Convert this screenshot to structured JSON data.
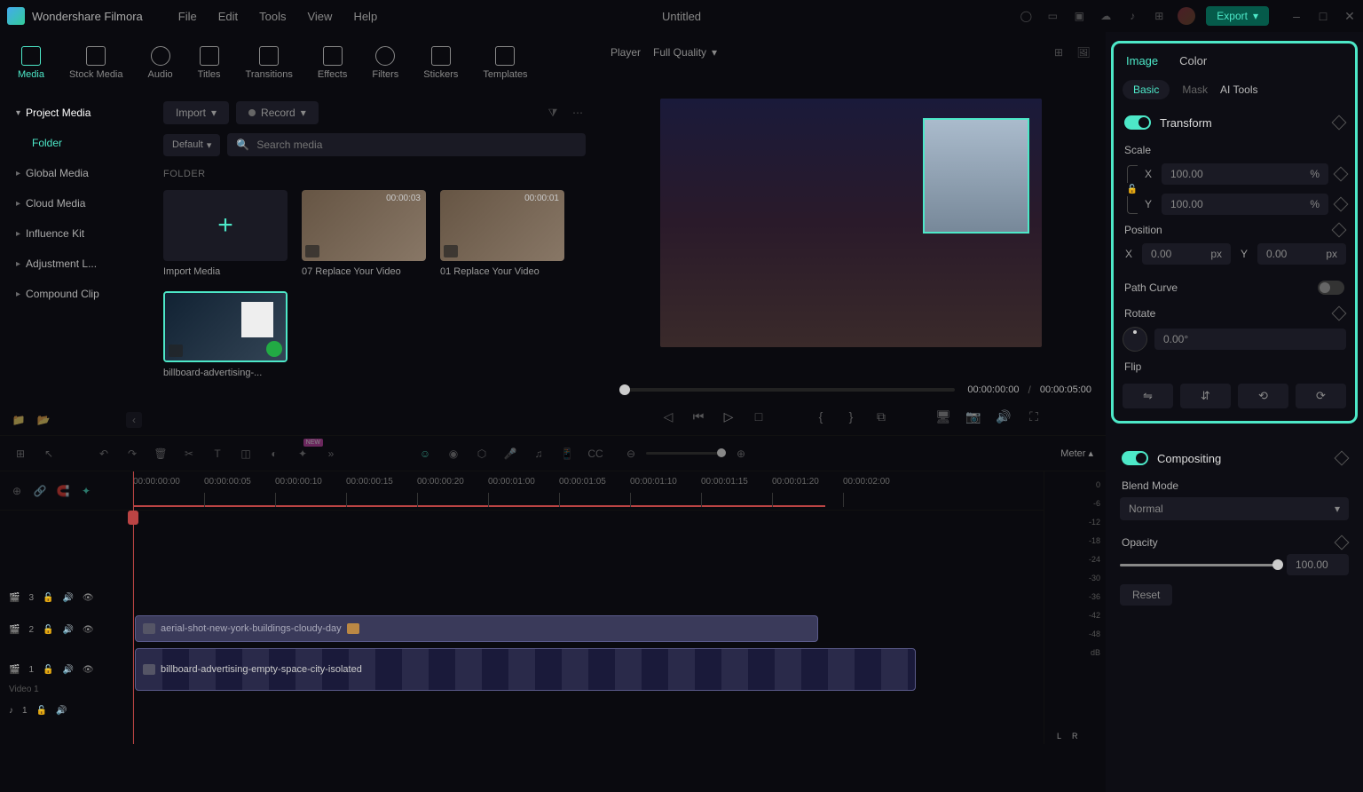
{
  "app_name": "Wondershare Filmora",
  "document_title": "Untitled",
  "menu": [
    "File",
    "Edit",
    "Tools",
    "View",
    "Help"
  ],
  "export_label": "Export",
  "top_tabs": [
    {
      "label": "Media",
      "active": true
    },
    {
      "label": "Stock Media"
    },
    {
      "label": "Audio"
    },
    {
      "label": "Titles"
    },
    {
      "label": "Transitions"
    },
    {
      "label": "Effects"
    },
    {
      "label": "Filters"
    },
    {
      "label": "Stickers"
    },
    {
      "label": "Templates"
    }
  ],
  "sidebar": {
    "items": [
      {
        "label": "Project Media",
        "active": true
      },
      {
        "label": "Folder",
        "highlight": true
      },
      {
        "label": "Global Media"
      },
      {
        "label": "Cloud Media"
      },
      {
        "label": "Influence Kit"
      },
      {
        "label": "Adjustment L..."
      },
      {
        "label": "Compound Clip"
      }
    ]
  },
  "media_toolbar": {
    "import": "Import",
    "record": "Record",
    "sort": "Default",
    "search_placeholder": "Search media"
  },
  "folder_label": "FOLDER",
  "media_items": [
    {
      "label": "Import Media",
      "type": "import"
    },
    {
      "label": "07 Replace Your Video",
      "duration": "00:00:03"
    },
    {
      "label": "01 Replace Your Video",
      "duration": "00:00:01"
    },
    {
      "label": "billboard-advertising-...",
      "selected": true
    }
  ],
  "preview": {
    "player_label": "Player",
    "quality": "Full Quality",
    "current_time": "00:00:00:00",
    "total_time": "00:00:05:00"
  },
  "props": {
    "tabs": [
      "Image",
      "Color"
    ],
    "subtabs": [
      "Basic",
      "Mask",
      "AI Tools"
    ],
    "transform": {
      "title": "Transform",
      "scale_label": "Scale",
      "scale_x": "100.00",
      "scale_y": "100.00",
      "position_label": "Position",
      "pos_x": "0.00",
      "pos_y": "0.00",
      "path_curve": "Path Curve",
      "rotate_label": "Rotate",
      "rotate_value": "0.00°",
      "flip_label": "Flip"
    },
    "compositing": {
      "title": "Compositing",
      "blend_label": "Blend Mode",
      "blend_value": "Normal",
      "opacity_label": "Opacity",
      "opacity_value": "100.00",
      "reset": "Reset"
    }
  },
  "timeline": {
    "meter_label": "Meter",
    "ruler": [
      "00:00:00:00",
      "00:00:00:05",
      "00:00:00:10",
      "00:00:00:15",
      "00:00:00:20",
      "00:00:01:00",
      "00:00:01:05",
      "00:00:01:10",
      "00:00:01:15",
      "00:00:01:20",
      "00:00:02:00"
    ],
    "tracks": [
      {
        "name": "3"
      },
      {
        "name": "2"
      },
      {
        "name": "1",
        "label": "Video 1"
      },
      {
        "name": "1",
        "audio": true
      }
    ],
    "clip1": "aerial-shot-new-york-buildings-cloudy-day",
    "clip2": "billboard-advertising-empty-space-city-isolated",
    "meter_scale": [
      "0",
      "-6",
      "-12",
      "-18",
      "-24",
      "-30",
      "-36",
      "-42",
      "-48"
    ],
    "meter_db": "dB",
    "meter_lr": [
      "L",
      "R"
    ]
  },
  "axis": {
    "x": "X",
    "y": "Y"
  },
  "units": {
    "pct": "%",
    "px": "px"
  }
}
